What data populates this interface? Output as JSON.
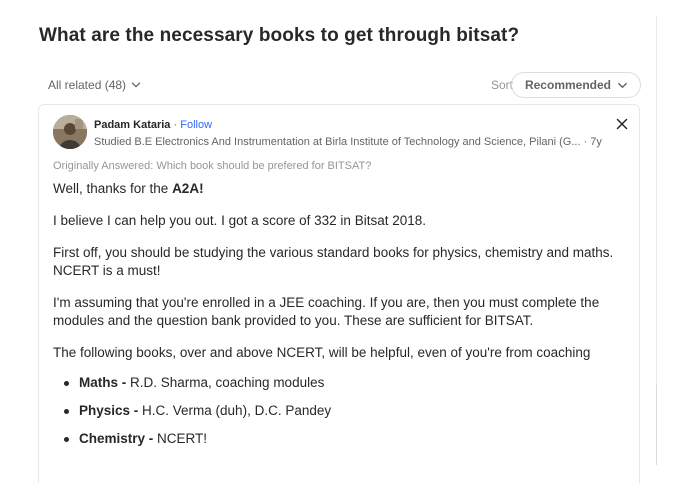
{
  "question": {
    "title": "What are the necessary books to get through bitsat?"
  },
  "filters": {
    "related_label": "All related (48)",
    "sort_label": "Sort",
    "sort_value": "Recommended"
  },
  "answer": {
    "author_name": "Padam Kataria",
    "separator": "·",
    "follow_label": "Follow",
    "credential": "Studied B.E Electronics And Instrumentation at Birla Institute of Technology and Science, Pilani (G... · 7y",
    "originally_answered": "Originally Answered: Which book should be prefered for BITSAT?",
    "p1_text": "Well, thanks for the ",
    "p1_bold": "A2A!",
    "p2": "I believe I can help you out. I got a score of 332 in Bitsat 2018.",
    "p3": "First off, you should be studying the various standard books for physics, chemistry and maths. NCERT is a must!",
    "p4": "I'm assuming that you're enrolled in a JEE coaching. If you are, then you must complete the modules and the question bank provided to you. These are sufficient for BITSAT.",
    "p5": "The following books, over and above NCERT, will be helpful, even of you're from coaching",
    "list": [
      {
        "subject": "Maths -",
        "books": " R.D. Sharma, coaching modules"
      },
      {
        "subject": "Physics -",
        "books": " H.C. Verma (duh), D.C. Pandey"
      },
      {
        "subject": "Chemistry -",
        "books": " NCERT!"
      }
    ]
  },
  "icons": {
    "related_dropdown": "chevron-down-icon",
    "sort_dropdown": "chevron-down-icon",
    "close": "close-icon",
    "avatar": "avatar"
  },
  "colors": {
    "link": "#2e69ff",
    "text": "#282829",
    "muted": "#636466"
  }
}
